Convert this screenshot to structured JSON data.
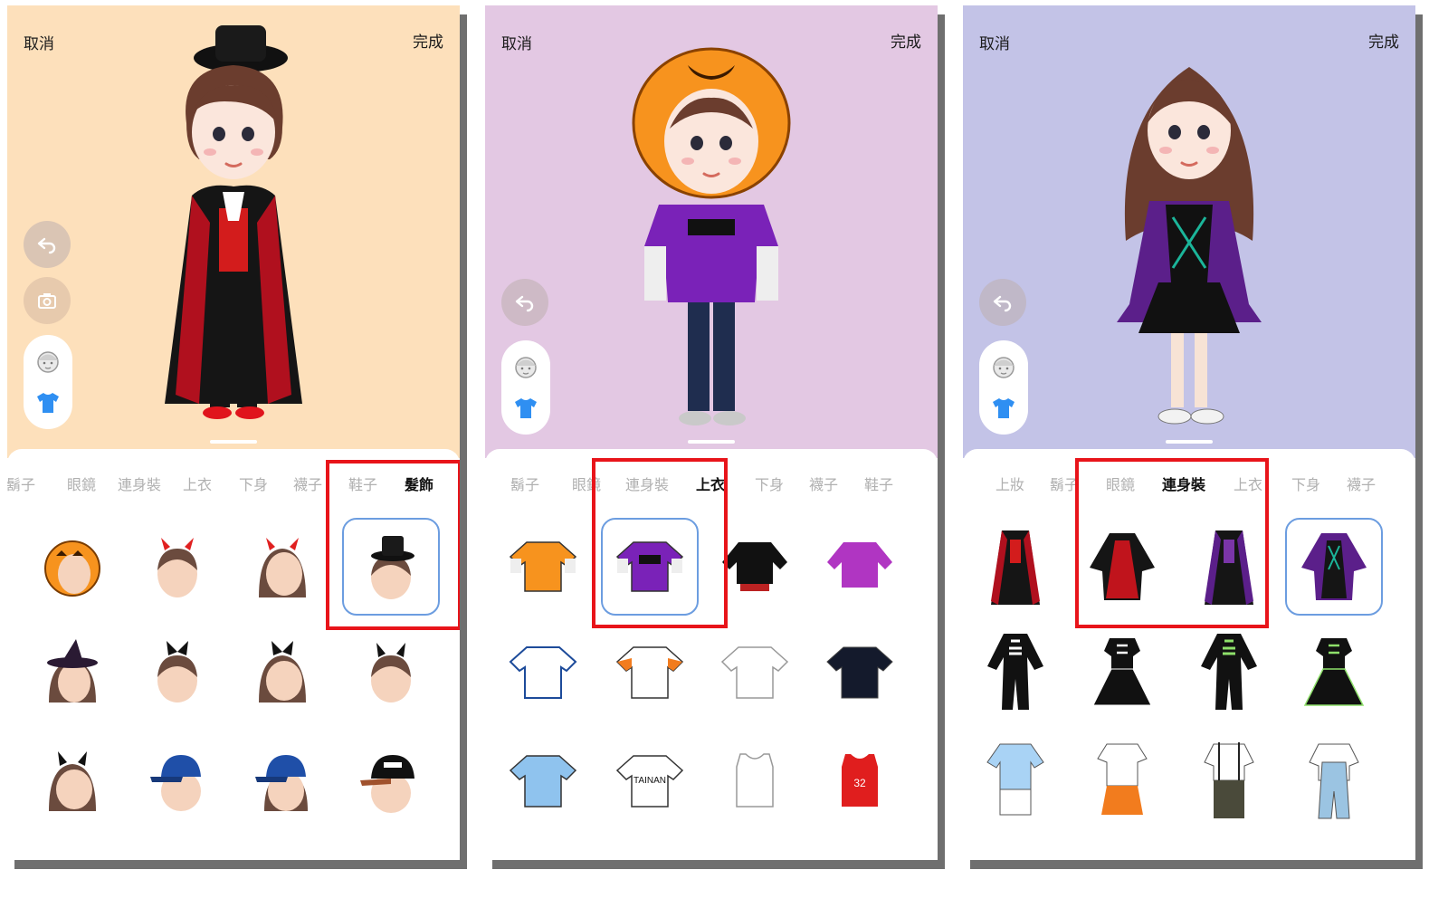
{
  "colors": {
    "highlight": "#e8141a",
    "selected_border": "#6c9de0",
    "bg_panel1": "#fde0bb",
    "bg_panel2": "#e3c8e3",
    "bg_panel3": "#c3c3e7"
  },
  "panels": [
    {
      "cancel": "取消",
      "done": "完成",
      "tabs": [
        "鬍子",
        "眼鏡",
        "連身裝",
        "上衣",
        "下身",
        "襪子",
        "鞋子",
        "髮飾"
      ],
      "active_tab": "髮飾",
      "icons": [
        "undo-icon",
        "camera-icon",
        "face-icon",
        "shirt-icon"
      ],
      "items": [
        [
          "pumpkin-hood",
          "devil-horns-short-hair",
          "devil-horns-long-hair",
          "top-hat"
        ],
        [
          "witch-hat",
          "bow-short-hair",
          "bow-long-hair",
          "black-horns-short-hair"
        ],
        [
          "black-horns-long-hair",
          "blue-cap-short-hair",
          "blue-cap-long-hair",
          "black-cap"
        ]
      ]
    },
    {
      "cancel": "取消",
      "done": "完成",
      "tabs": [
        "鬍子",
        "眼鏡",
        "連身裝",
        "上衣",
        "下身",
        "襪子",
        "鞋子"
      ],
      "active_tab": "上衣",
      "icons": [
        "undo-icon",
        "face-icon",
        "shirt-icon"
      ],
      "items": [
        [
          "orange-halloween-shirt",
          "purple-halloween-shirt",
          "trick-or-treat-black",
          "trick-or-treat-purple"
        ],
        [
          "white-jersey-blue",
          "white-jersey-orange",
          "white-jersey-plain",
          "navy-jersey"
        ],
        [
          "light-blue-jersey",
          "tainan-jersey",
          "white-tank",
          "red-basketball-jersey"
        ]
      ],
      "tainan_label": "TAINAN",
      "jersey_number": "32"
    },
    {
      "cancel": "取消",
      "done": "完成",
      "tabs": [
        "上妝",
        "鬍子",
        "眼鏡",
        "連身裝",
        "上衣",
        "下身",
        "襪子"
      ],
      "active_tab": "連身裝",
      "icons": [
        "undo-icon",
        "face-icon",
        "shirt-icon"
      ],
      "items": [
        [
          "vampire-coat",
          "red-vampire-dress",
          "purple-vampire-coat",
          "purple-witch-dress"
        ],
        [
          "skeleton-suit",
          "skeleton-dress",
          "green-skeleton-suit",
          "green-skeleton-dress"
        ],
        [
          "light-blue-outfit",
          "cheerleader-outfit",
          "suspender-outfit",
          "denim-overalls"
        ]
      ]
    }
  ]
}
